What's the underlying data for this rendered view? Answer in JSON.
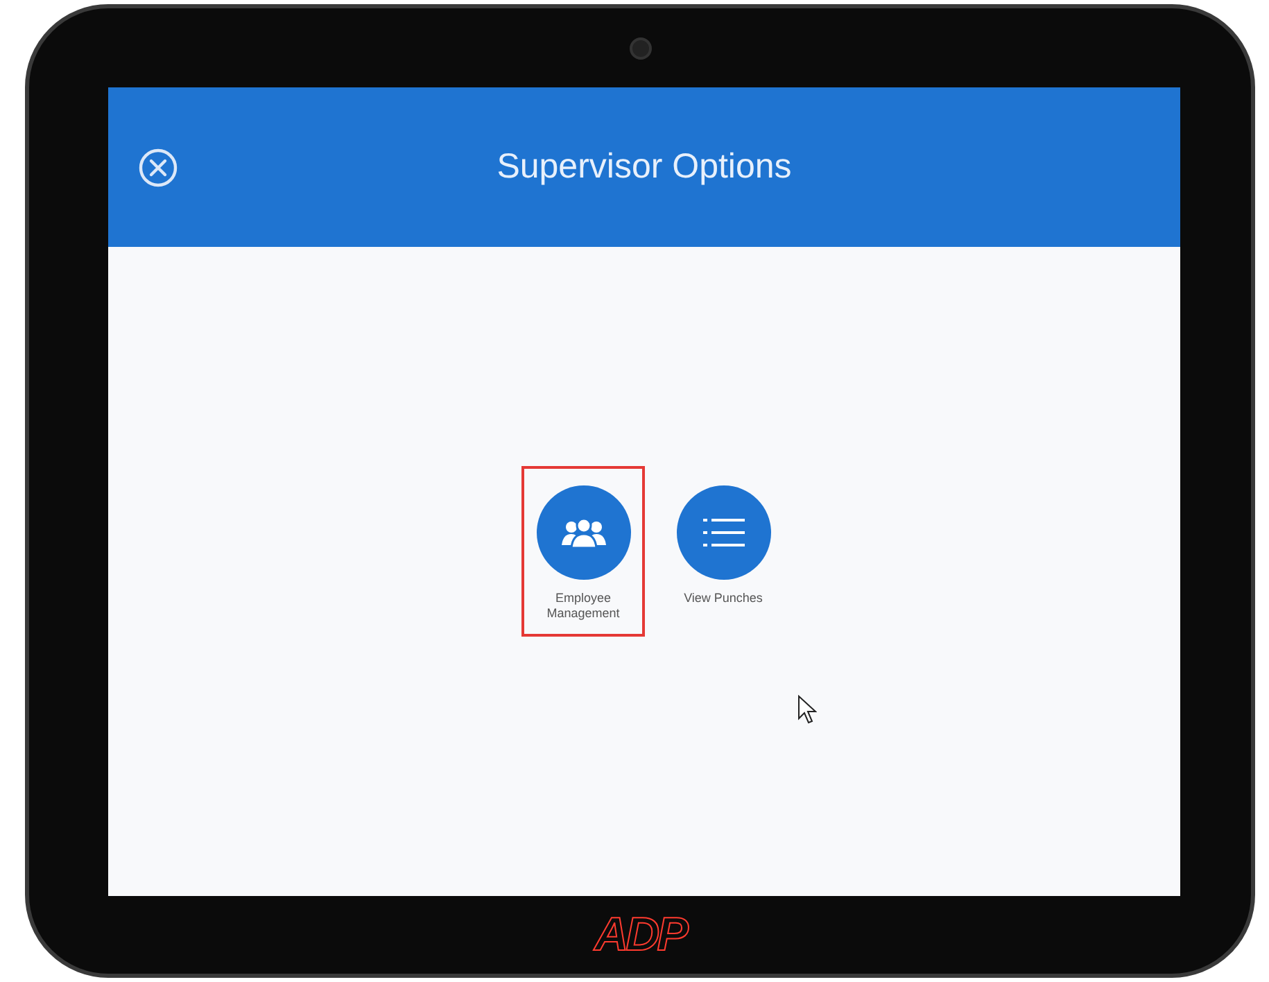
{
  "header": {
    "title": "Supervisor Options"
  },
  "options": [
    {
      "kind": "people",
      "label": "Employee Management",
      "highlighted": true
    },
    {
      "kind": "list",
      "label": "View Punches",
      "highlighted": false
    }
  ],
  "brand": {
    "logo": "ADP"
  }
}
